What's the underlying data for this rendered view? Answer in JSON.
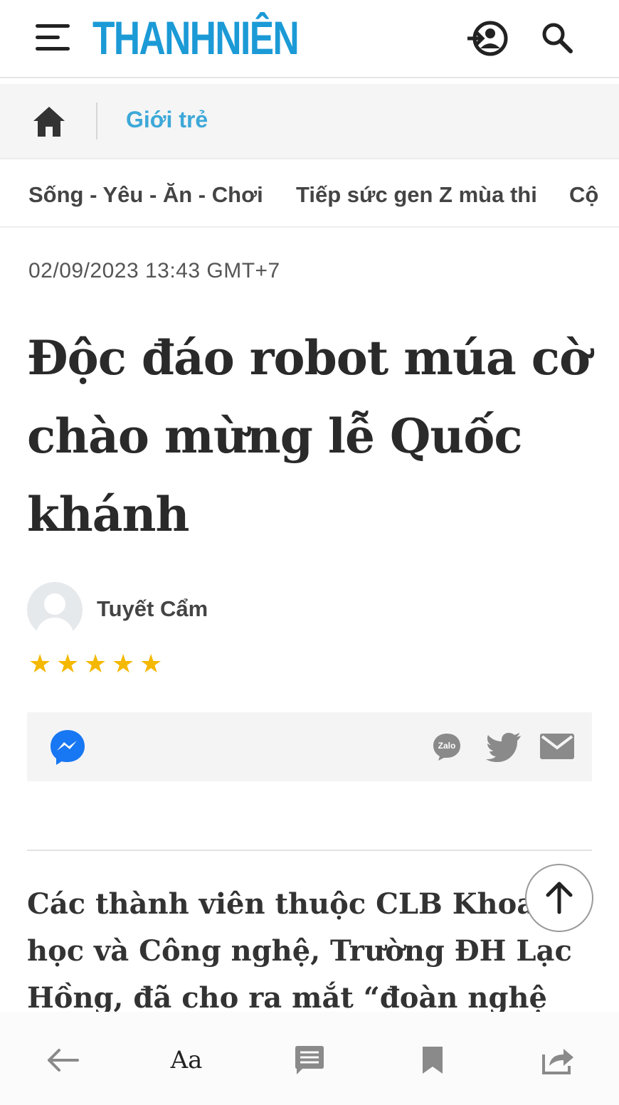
{
  "header": {
    "logo_text": "THANHNIÊN",
    "icons": {
      "menu": "hamburger-menu-icon",
      "login": "user-login-icon",
      "search": "search-icon"
    }
  },
  "breadcrumb": {
    "home_icon": "home-icon",
    "section": "Giới trẻ"
  },
  "subnav": {
    "items": [
      "Sống - Yêu - Ăn - Chơi",
      "Tiếp sức gen Z mùa thi",
      "Cộ"
    ]
  },
  "article": {
    "date": "02/09/2023 13:43 GMT+7",
    "title": "Độc đáo robot múa cờ chào mừng lễ Quốc khánh",
    "author": "Tuyết Cẩm",
    "rating": {
      "stars": 5,
      "symbol": "★"
    },
    "lead": "Các thành viên thuộc CLB Khoa học và Công nghệ, Trường ĐH Lạc Hồng, đã cho ra mắt “đoàn nghệ thuật"
  },
  "share": {
    "zalo_label": "Zalo"
  },
  "toolbar": {
    "font_label": "Aa"
  },
  "colors": {
    "brand": "#1b9ad6",
    "section": "#3da8d8",
    "star": "#f5b800",
    "messenger": "#1877f2",
    "icon_gray": "#8a8a8a"
  }
}
